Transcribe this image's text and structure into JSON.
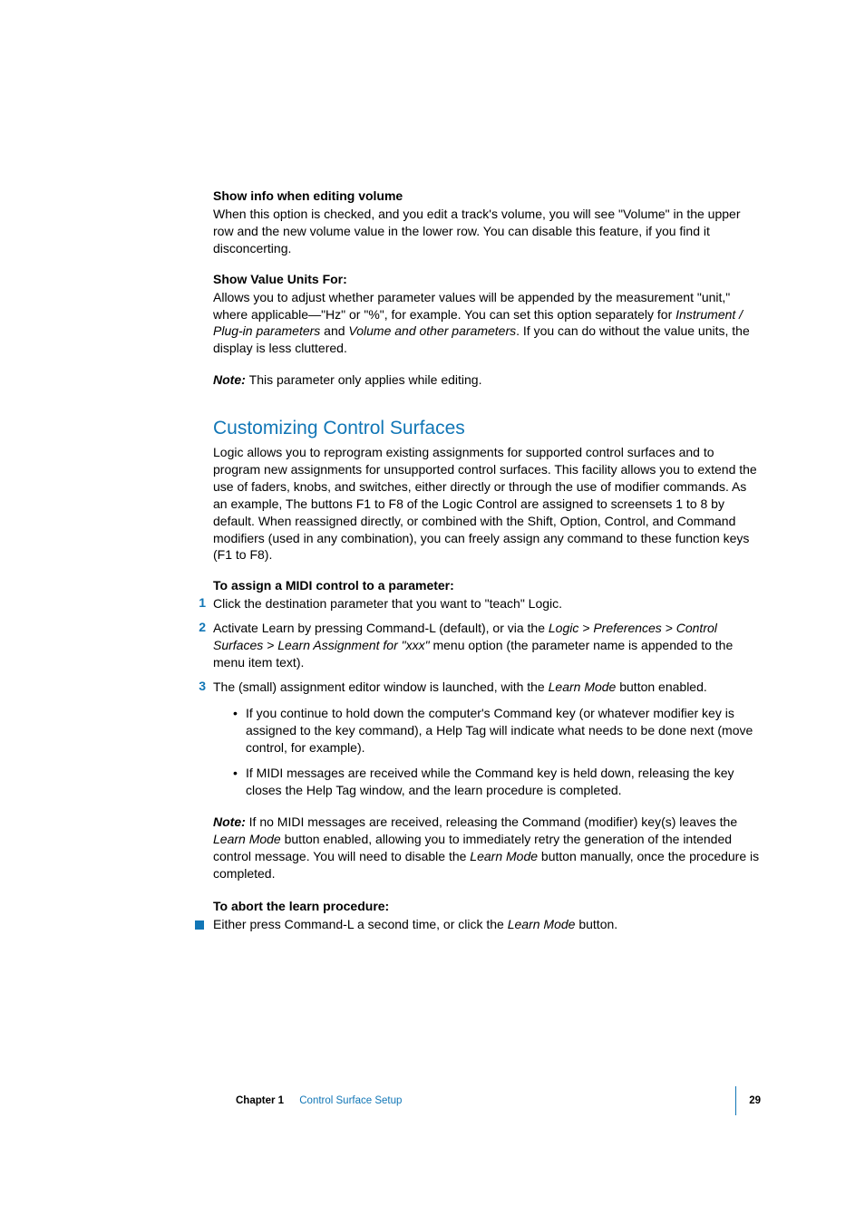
{
  "sec1": {
    "heading": "Show info when editing volume",
    "text": "When this option is checked, and you edit a track's volume, you will see \"Volume\" in the upper row and the new volume value in the lower row. You can disable this feature, if you find it disconcerting."
  },
  "sec2": {
    "heading": "Show Value Units For:",
    "p_before": "Allows you to adjust whether parameter values will be appended by the measurement \"unit,\" where applicable—\"Hz\" or \"%\", for example. You can set this option separately for ",
    "i1": "Instrument / Plug-in parameters",
    "mid": " and ",
    "i2": "Volume and other parameters",
    "p_after": ". If you can do without the value units, the display is less cluttered.",
    "note_label": "Note:  ",
    "note_text": "This parameter only applies while editing."
  },
  "h1": "Customizing Control Surfaces",
  "h1_body": "Logic allows you to reprogram existing assignments for supported control surfaces and to program new assignments for unsupported control surfaces. This facility allows you to extend the use of faders, knobs, and switches, either directly or through the use of modifier commands. As an example, The buttons F1 to F8 of the Logic Control are assigned to screensets 1 to 8 by default. When reassigned directly, or combined with the Shift, Option, Control, and Command modifiers (used in any combination), you can freely assign any command to these function keys (F1 to F8).",
  "steps_heading1": "To assign a MIDI control to a parameter:",
  "step1": {
    "num": "1",
    "text": "Click the destination parameter that you want to \"teach\" Logic."
  },
  "step2": {
    "num": "2",
    "pre": "Activate Learn by pressing Command-L (default), or via the ",
    "i1": "Logic > Preferences > Control Surfaces > Learn Assignment for \"xxx\"",
    "post": " menu option (the parameter name is appended to the menu item text)."
  },
  "step3": {
    "num": "3",
    "pre": "The (small) assignment editor window is launched, with the ",
    "i1": "Learn Mode",
    "post": " button enabled.",
    "b1": "If you continue to hold down the computer's Command key (or whatever modifier key is assigned to the key command), a Help Tag will indicate what needs to be done next (move control, for example).",
    "b2": "If MIDI messages are received while the Command key is held down, releasing the key closes the Help Tag window, and the learn procedure is completed.",
    "note_label": "Note:  ",
    "note_pre": "If no MIDI messages are received, releasing the Command (modifier) key(s) leaves the ",
    "note_i1": "Learn Mode",
    "note_mid": " button enabled, allowing you to immediately retry the generation of the intended control message. You will need to disable the ",
    "note_i2": "Learn Mode",
    "note_post": " button manually, once the procedure is completed."
  },
  "steps_heading2": "To abort the learn procedure:",
  "abort": {
    "pre": "Either press Command-L a second time, or click the ",
    "i1": "Learn Mode",
    "post": " button."
  },
  "footer": {
    "chapter": "Chapter 1",
    "title": "Control Surface Setup",
    "page": "29"
  }
}
